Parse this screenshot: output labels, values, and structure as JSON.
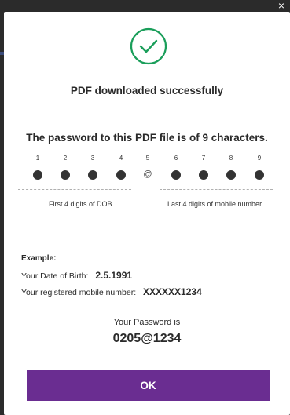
{
  "window": {
    "close_glyph": "×"
  },
  "dialog": {
    "icon": "check-circle-icon",
    "accent_color": "#1a9e5a",
    "success_message": "PDF downloaded successfully",
    "password_title": "The password to this PDF file is of 9 characters.",
    "positions": [
      "1",
      "2",
      "3",
      "4",
      "5",
      "6",
      "7",
      "8",
      "9"
    ],
    "separator_char": "@",
    "left_caption": "First 4 digits of DOB",
    "right_caption": "Last 4 digits of mobile number",
    "example": {
      "label": "Example:",
      "dob_label": "Your Date of Birth:",
      "dob_value": "2.5.1991",
      "mobile_label": "Your registered mobile number:",
      "mobile_value": "XXXXXX1234"
    },
    "password_label": "Your Password is",
    "password_value": "0205@1234",
    "ok_label": "OK",
    "button_color": "#6a2d91"
  }
}
